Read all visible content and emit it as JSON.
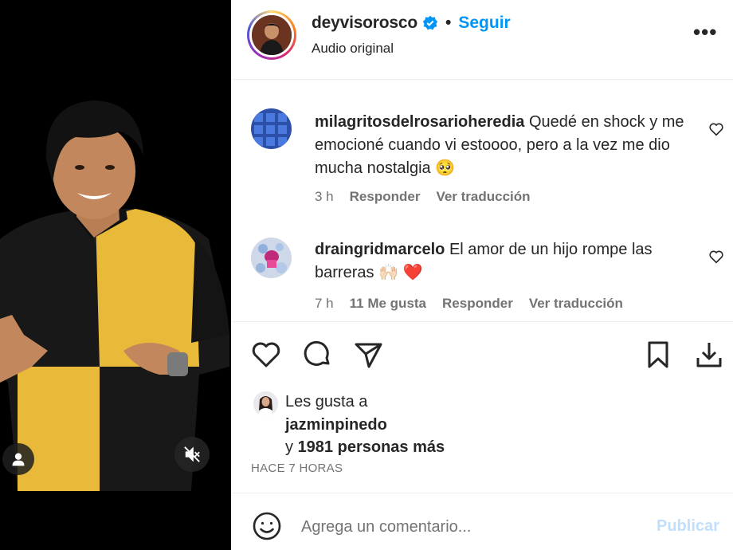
{
  "post": {
    "owner": "deyvisorosco",
    "separator": "•",
    "follow_label": "Seguir",
    "audio_label": "Audio original",
    "more_label": "•••",
    "verified_icon": "verified-badge-icon",
    "accent_color": "#0095f6"
  },
  "comments": [
    {
      "user": "milagritosdelrosarioheredia",
      "text": "Quedé en shock y me emocioné cuando vi estoooo, pero a la vez me dio mucha nostalgia 🥺",
      "time": "3 h",
      "likes": "",
      "reply_label": "Responder",
      "translate_label": "Ver traducción"
    },
    {
      "user": "draingridmarcelo",
      "text": "El amor de un hijo rompe las barreras 🙌🏻 ❤️",
      "time": "7 h",
      "likes": "11 Me gusta",
      "reply_label": "Responder",
      "translate_label": "Ver traducción"
    }
  ],
  "likes": {
    "prefix": "Les gusta a",
    "user": "jazminpinedo",
    "and": "y",
    "others": "1981 personas más"
  },
  "time_ago": "HACE 7 HORAS",
  "add_comment": {
    "placeholder": "Agrega un comentario...",
    "publish_label": "Publicar"
  }
}
